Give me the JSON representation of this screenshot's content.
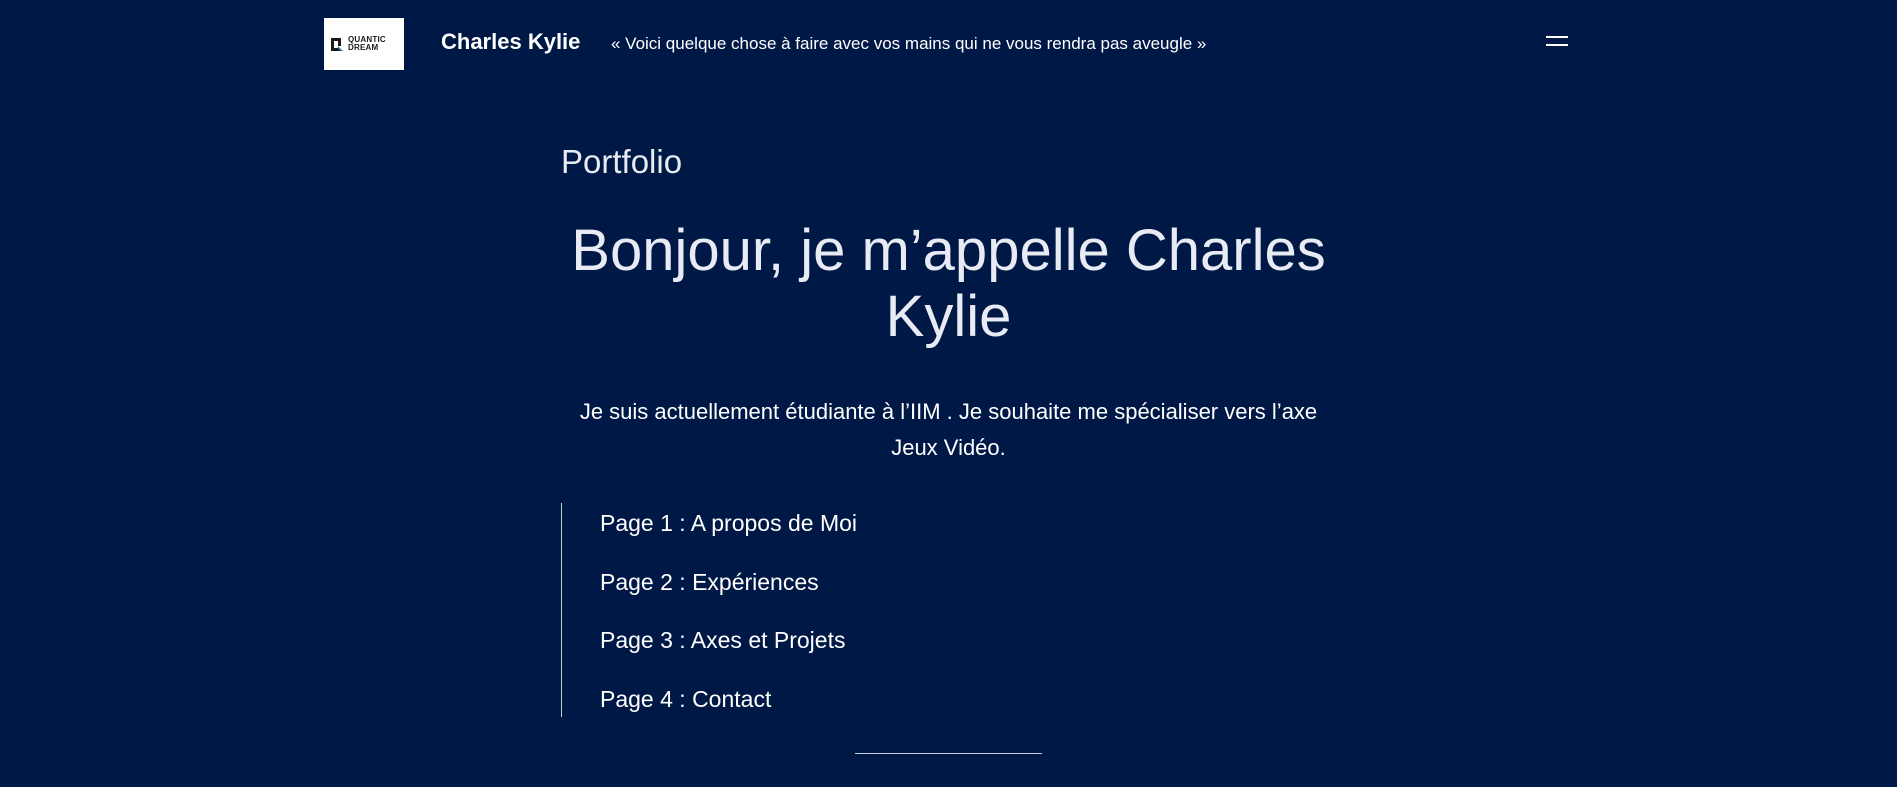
{
  "header": {
    "logo": {
      "line1": "QUANTIC",
      "line2": "DREAM"
    },
    "site_title": "Charles Kylie",
    "tagline": "« Voici quelque chose à faire avec vos mains qui ne vous rendra pas aveugle »",
    "menu_icon": "hamburger-menu-icon"
  },
  "main": {
    "kicker": "Portfolio",
    "headline": "Bonjour, je m’appelle Charles Kylie",
    "intro": "Je suis actuellement étudiante à l’IIM . Je souhaite me spécialiser vers l’axe Jeux Vidéo.",
    "pages": [
      {
        "label": "Page 1 : A propos de Moi"
      },
      {
        "label": "Page 2 : Expériences"
      },
      {
        "label": "Page 3 : Axes et Projets"
      },
      {
        "label": "Page 4 : Contact"
      }
    ]
  },
  "colors": {
    "background": "#001845",
    "text": "#ffffff",
    "heading_text": "#e8ebf3",
    "rule": "#c8ccd6",
    "logo_blue": "#1e88c8"
  }
}
